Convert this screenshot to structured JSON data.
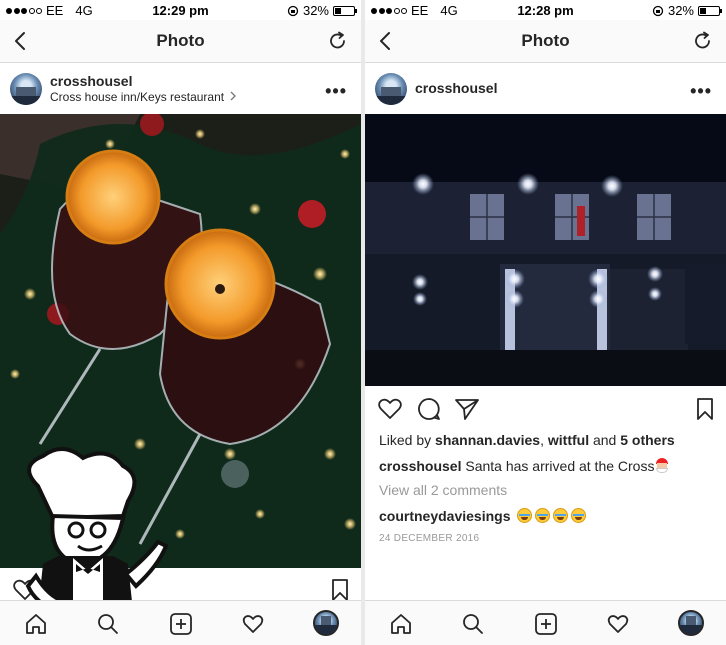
{
  "left": {
    "status": {
      "carrier": "EE",
      "network": "4G",
      "time": "12:29 pm",
      "battery": "32%",
      "battery_level": 0.32
    },
    "nav": {
      "title": "Photo"
    },
    "post": {
      "username": "crosshousel",
      "location": "Cross house inn/Keys restaurant"
    },
    "icons": [
      "back-icon",
      "refresh-icon",
      "more-icon",
      "heart-icon",
      "bookmark-icon",
      "home-icon",
      "search-icon",
      "add-icon",
      "activity-icon",
      "profile-icon"
    ]
  },
  "right": {
    "status": {
      "carrier": "EE",
      "network": "4G",
      "time": "12:28 pm",
      "battery": "32%",
      "battery_level": 0.32
    },
    "nav": {
      "title": "Photo"
    },
    "post": {
      "username": "crosshousel",
      "likes_prefix": "Liked by ",
      "liker1": "shannan.davies",
      "sep": ", ",
      "liker2": "wittful",
      "and": " and ",
      "others": "5 others",
      "caption_user": "crosshousel",
      "caption_text": " Santa has arrived at the Cross",
      "view_comments": "View all 2 comments",
      "comment_user": "courtneydaviesings",
      "date": "24 DECEMBER 2016"
    }
  },
  "colors": {
    "text": "#262626",
    "muted": "#999999",
    "divider": "#dbdbdb",
    "bar": "#fafafa"
  }
}
